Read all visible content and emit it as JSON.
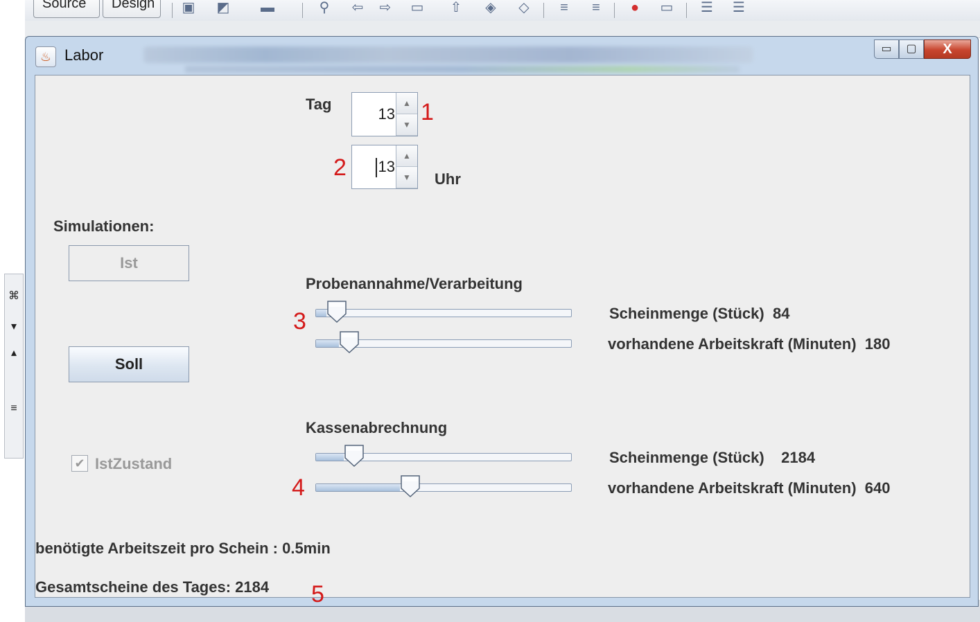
{
  "ide": {
    "tabs": [
      "Source",
      "Design"
    ]
  },
  "window": {
    "title": "Labor",
    "minimize_label": "▭",
    "maximize_label": "▢",
    "close_label": "X"
  },
  "form": {
    "tag_label": "Tag",
    "tag_value": "13",
    "hour_value": "13",
    "uhr_label": "Uhr",
    "simulations_label": "Simulationen:",
    "ist_button": "Ist",
    "soll_button": "Soll",
    "istzustand_label": "IstZustand",
    "istzustand_checked": true,
    "section1": {
      "title": "Probenannahme/Verarbeitung",
      "sliders": [
        {
          "label": "Scheinmenge (Stück)",
          "value_text": "84",
          "fraction": 0.04
        },
        {
          "label": "vorhandene Arbeitskraft (Minuten)",
          "value_text": "180",
          "fraction": 0.09
        }
      ]
    },
    "section2": {
      "title": "Kassenabrechnung",
      "sliders": [
        {
          "label": "Scheinmenge (Stück)",
          "value_text": "2184",
          "fraction": 0.11
        },
        {
          "label": "vorhandene Arbeitskraft (Minuten)",
          "value_text": "640",
          "fraction": 0.33
        }
      ]
    },
    "arbeitszeit_text": "benötigte Arbeitszeit pro Schein : 0.5min",
    "gesamtscheine_text": "Gesamtscheine des Tages: 2184"
  },
  "annotations": [
    "1",
    "2",
    "3",
    "4",
    "5"
  ],
  "colors": {
    "annotation": "#d41a1a",
    "close_button": "#c8452e",
    "client_bg": "#eeeeee"
  }
}
